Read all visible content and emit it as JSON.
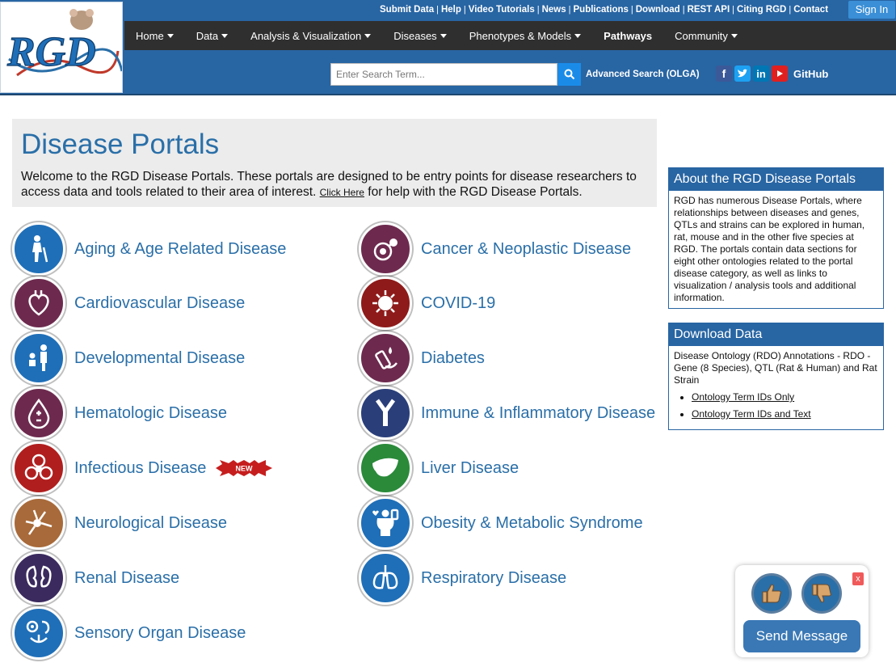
{
  "header": {
    "logo_text": "RGD",
    "top_links": [
      "Submit Data",
      "Help",
      "Video Tutorials",
      "News",
      "Publications",
      "Download",
      "REST API",
      "Citing RGD",
      "Contact"
    ],
    "sign_in": "Sign In",
    "nav": [
      {
        "label": "Home",
        "dropdown": true
      },
      {
        "label": "Data",
        "dropdown": true
      },
      {
        "label": "Analysis & Visualization",
        "dropdown": true
      },
      {
        "label": "Diseases",
        "dropdown": true
      },
      {
        "label": "Phenotypes & Models",
        "dropdown": true
      },
      {
        "label": "Pathways",
        "dropdown": false
      },
      {
        "label": "Community",
        "dropdown": true
      }
    ],
    "search_placeholder": "Enter Search Term...",
    "advanced_search": "Advanced Search (OLGA)",
    "social": [
      "facebook-icon",
      "twitter-icon",
      "linkedin-icon",
      "youtube-icon"
    ],
    "github": "GitHub"
  },
  "intro": {
    "title": "Disease Portals",
    "text_before": "Welcome to the RGD Disease Portals. These portals are designed to be entry points for disease researchers to access data and tools related to their area of interest.",
    "link": "Click Here",
    "text_after": " for help with the RGD Disease Portals."
  },
  "portals": [
    {
      "label": "Aging & Age Related Disease",
      "color": "#1f6fb8",
      "icon": "elderly-icon"
    },
    {
      "label": "Cancer & Neoplastic Disease",
      "color": "#6d2a4e",
      "icon": "cancer-cell-icon"
    },
    {
      "label": "Cardiovascular Disease",
      "color": "#6d2a4e",
      "icon": "heart-icon"
    },
    {
      "label": "COVID-19",
      "color": "#8e1a1a",
      "icon": "virus-icon"
    },
    {
      "label": "Developmental Disease",
      "color": "#1f6fb8",
      "icon": "child-icon"
    },
    {
      "label": "Diabetes",
      "color": "#6d2a4e",
      "icon": "glucose-test-icon"
    },
    {
      "label": "Hematologic Disease",
      "color": "#6d2a4e",
      "icon": "blood-drop-icon"
    },
    {
      "label": "Immune & Inflammatory Disease",
      "color": "#2a3f7a",
      "icon": "antibody-icon"
    },
    {
      "label": "Infectious Disease",
      "color": "#b01e1e",
      "icon": "biohazard-icon",
      "badge": "NEW"
    },
    {
      "label": "Liver Disease",
      "color": "#2a8a3a",
      "icon": "liver-icon"
    },
    {
      "label": "Neurological Disease",
      "color": "#a86a3a",
      "icon": "neuron-icon"
    },
    {
      "label": "Obesity & Metabolic Syndrome",
      "color": "#1f6fb8",
      "icon": "obesity-icon"
    },
    {
      "label": "Renal Disease",
      "color": "#3a2a5e",
      "icon": "kidney-icon"
    },
    {
      "label": "Respiratory Disease",
      "color": "#1f6fb8",
      "icon": "lungs-icon"
    },
    {
      "label": "Sensory Organ Disease",
      "color": "#1f6fb8",
      "icon": "senses-icon"
    }
  ],
  "about": {
    "title": "About the RGD Disease Portals",
    "text": "RGD has numerous Disease Portals, where relationships between diseases and genes, QTLs and strains can be explored in human, rat, mouse and in the other five species at RGD. The portals contain data sections for eight other ontologies related to the portal disease category, as well as links to visualization / analysis tools and additional information."
  },
  "download": {
    "title": "Download Data",
    "text": "Disease Ontology (RDO) Annotations - RDO - Gene (8 Species), QTL (Rat & Human) and Rat Strain",
    "links": [
      "Ontology Term IDs Only",
      "Ontology Term IDs and Text"
    ]
  },
  "feedback": {
    "close": "x",
    "send": "Send Message"
  }
}
